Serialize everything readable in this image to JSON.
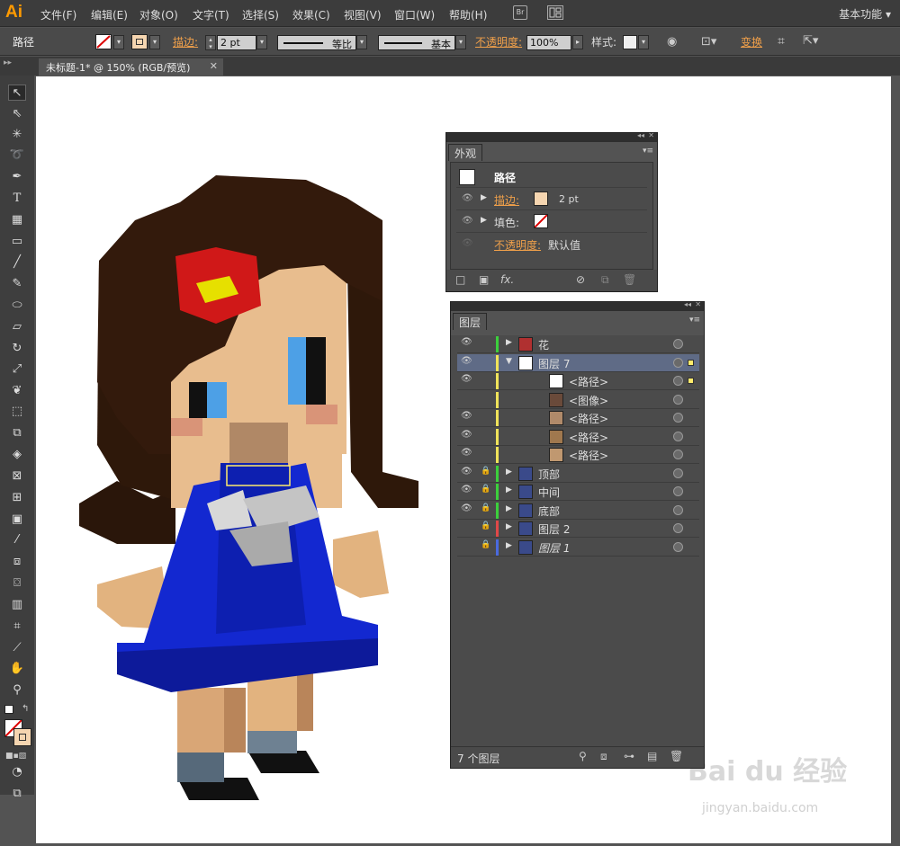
{
  "app": {
    "logo": "Ai",
    "workspace": "基本功能 ▾"
  },
  "menu": [
    "文件(F)",
    "编辑(E)",
    "对象(O)",
    "文字(T)",
    "选择(S)",
    "效果(C)",
    "视图(V)",
    "窗口(W)",
    "帮助(H)"
  ],
  "menu_icons": {
    "bridge": "Br"
  },
  "control": {
    "selection_label": "路径",
    "stroke_label": "描边:",
    "stroke_weight": "2 pt",
    "profile": "等比",
    "brush": "基本",
    "opacity_label": "不透明度:",
    "opacity_value": "100%",
    "style_label": "样式:",
    "transform_label": "变换"
  },
  "document_tab": {
    "title": "未标题-1* @ 150% (RGB/预览)",
    "close": "✕"
  },
  "appearance": {
    "tab": "外观",
    "object": "路径",
    "stroke_label": "描边:",
    "stroke_value": "2 pt",
    "fill_label": "填色:",
    "opacity_label": "不透明度:",
    "opacity_value": "默认值",
    "fx": "fx."
  },
  "layers": {
    "tab": "图层",
    "footer": "7 个图层",
    "rows": [
      {
        "name": "花",
        "expand": "▶",
        "color": "#3ccf3c",
        "thumb": "#b03030"
      },
      {
        "name": "图层 7",
        "expand": "▼",
        "color": "#f0e35a",
        "thumb": "#ffffff",
        "selected": true
      },
      {
        "name": "<路径>",
        "expand": "",
        "color": "#f0e35a",
        "thumb": "#ffffff",
        "indent": true
      },
      {
        "name": "<图像>",
        "expand": "",
        "color": "#f0e35a",
        "thumb": "#6a4a3a",
        "indent": true
      },
      {
        "name": "<路径>",
        "expand": "",
        "color": "#f0e35a",
        "thumb": "#b08a6a",
        "indent": true
      },
      {
        "name": "<路径>",
        "expand": "",
        "color": "#f0e35a",
        "thumb": "#a0784e",
        "indent": true
      },
      {
        "name": "<路径>",
        "expand": "",
        "color": "#f0e35a",
        "thumb": "#c09870",
        "indent": true
      },
      {
        "name": "顶部",
        "expand": "▶",
        "color": "#3ccf3c",
        "thumb": "#3a4a8a"
      },
      {
        "name": "中间",
        "expand": "▶",
        "color": "#3ccf3c",
        "thumb": "#3a4a8a"
      },
      {
        "name": "底部",
        "expand": "▶",
        "color": "#3ccf3c",
        "thumb": "#3a4a8a"
      },
      {
        "name": "图层 2",
        "expand": "▶",
        "color": "#e04848",
        "thumb": "#3a4a8a"
      },
      {
        "name": "图层 1",
        "expand": "▶",
        "color": "#4a6adf",
        "thumb": "#3a4a8a"
      }
    ]
  },
  "watermark": {
    "brand": "Bai du 经验",
    "url": "jingyan.baidu.com"
  },
  "colors": {
    "accent": "#f0a04a",
    "selection": "#ffeb6b",
    "hair": "#2e1a0e",
    "skin": "#e8bd8e",
    "dress": "#1020c8"
  }
}
